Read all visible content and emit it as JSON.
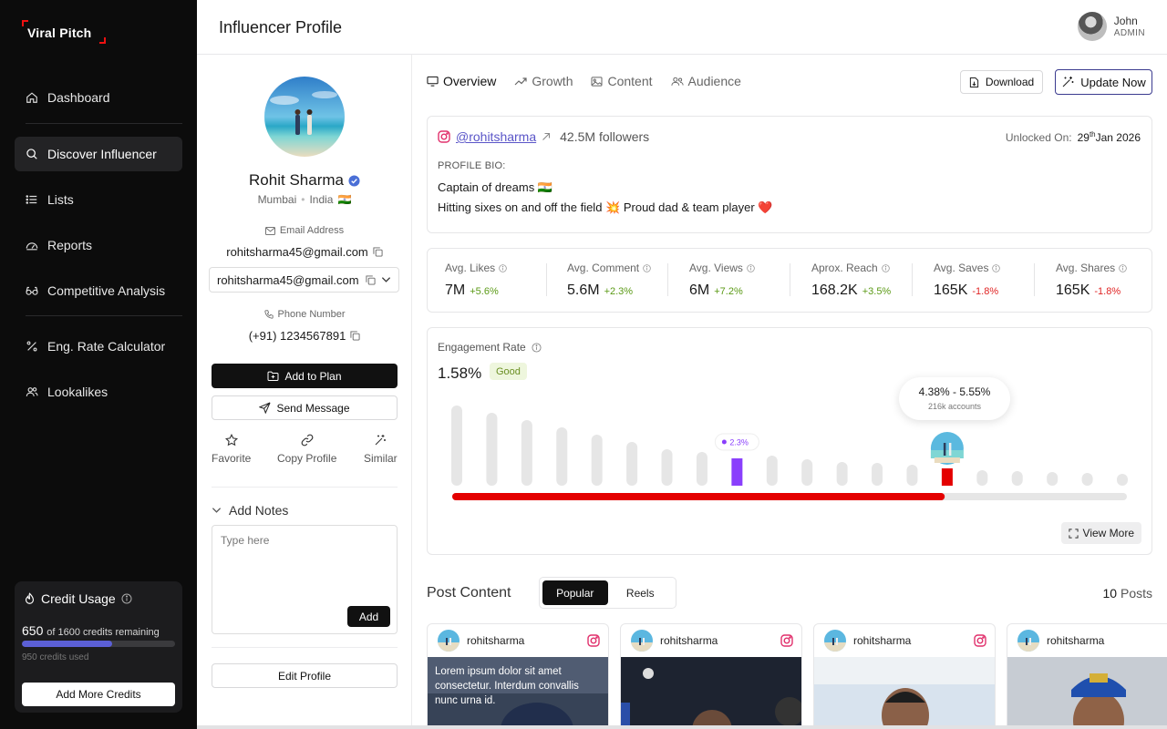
{
  "app": {
    "logo": "Viral Pitch"
  },
  "sidebar": {
    "items": [
      {
        "label": "Dashboard",
        "icon": "home-icon"
      },
      {
        "label": "Discover Influencer",
        "icon": "search-icon",
        "active": true
      },
      {
        "label": "Lists",
        "icon": "list-icon"
      },
      {
        "label": "Reports",
        "icon": "reports-icon"
      },
      {
        "label": "Competitive Analysis",
        "icon": "glasses-icon"
      },
      {
        "label": "Eng. Rate Calculator",
        "icon": "percent-icon"
      },
      {
        "label": "Lookalikes",
        "icon": "users-icon"
      }
    ],
    "credits": {
      "title": "Credit Usage",
      "remaining": "650",
      "remaining_text": "of 1600 credits remaining",
      "used_text": "950 credits used",
      "used_fraction": 0.59,
      "button": "Add More Credits"
    }
  },
  "header": {
    "title": "Influencer Profile",
    "user_name": "John",
    "user_role": "ADMIN"
  },
  "profile": {
    "name": "Rohit Sharma",
    "city": "Mumbai",
    "country": "India",
    "flag": "🇮🇳",
    "email_label": "Email Address",
    "email": "rohitsharma45@gmail.com",
    "email_select": "rohitsharma45@gmail.com",
    "phone_label": "Phone Number",
    "phone": "(+91) 1234567891",
    "add_to_plan": "Add to Plan",
    "send_message": "Send Message",
    "actions": {
      "favorite": "Favorite",
      "copy": "Copy Profile",
      "similar": "Similar"
    },
    "notes_title": "Add Notes",
    "notes_placeholder": "Type here",
    "notes_add": "Add",
    "edit_profile": "Edit Profile"
  },
  "tabs": [
    {
      "label": "Overview",
      "active": true
    },
    {
      "label": "Growth"
    },
    {
      "label": "Content"
    },
    {
      "label": "Audience"
    }
  ],
  "toolbar": {
    "download": "Download",
    "update": "Update Now"
  },
  "bio": {
    "handle": "@rohitsharma",
    "followers": "42.5M followers",
    "unlocked_label": "Unlocked On:",
    "unlocked_day": "29",
    "unlocked_suffix": "th",
    "unlocked_rest": "Jan 2026",
    "label": "PROFILE BIO:",
    "line1": "Captain of dreams 🇮🇳",
    "line2": "Hitting sixes on and off the field 💥 Proud dad & team player ❤️"
  },
  "stats": [
    {
      "label": "Avg. Likes",
      "value": "7M",
      "change": "+5.6%",
      "trend": "up"
    },
    {
      "label": "Avg. Comment",
      "value": "5.6M",
      "change": "+2.3%",
      "trend": "up"
    },
    {
      "label": "Avg. Views",
      "value": "6M",
      "change": "+7.2%",
      "trend": "up"
    },
    {
      "label": "Aprox. Reach",
      "value": "168.2K",
      "change": "+3.5%",
      "trend": "up"
    },
    {
      "label": "Avg. Saves",
      "value": "165K",
      "change": "-1.8%",
      "trend": "down"
    },
    {
      "label": "Avg. Shares",
      "value": "165K",
      "change": "-1.8%",
      "trend": "down"
    }
  ],
  "engagement": {
    "title": "Engagement Rate",
    "value": "1.58%",
    "badge": "Good",
    "marker_label": "2.3%",
    "tooltip_range": "4.38% - 5.55%",
    "tooltip_sub": "216k accounts",
    "view_more": "View More",
    "bar_levels": [
      88,
      80,
      72,
      64,
      56,
      48,
      40,
      37,
      30,
      33,
      29,
      26,
      25,
      23,
      19,
      17,
      16,
      15,
      14,
      13
    ],
    "highlight_purple_index": 8,
    "highlight_red_index": 14,
    "progress_fraction": 0.73,
    "colors": {
      "purple": "#8a3ffc",
      "red": "#e40000",
      "bar": "#e6e6e6",
      "good": "#6b8f24",
      "up": "#5b9a16",
      "down": "#e02424"
    }
  },
  "posts": {
    "title": "Post Content",
    "segments": [
      {
        "label": "Popular",
        "active": true
      },
      {
        "label": "Reels"
      }
    ],
    "count_number": "10",
    "count_label": "Posts",
    "items": [
      {
        "user": "rohitsharma",
        "caption": "Lorem ipsum dolor sit amet consectetur. Interdum convallis nunc urna id."
      },
      {
        "user": "rohitsharma",
        "caption": ""
      },
      {
        "user": "rohitsharma",
        "caption": ""
      },
      {
        "user": "rohitsharma",
        "caption": ""
      }
    ]
  }
}
